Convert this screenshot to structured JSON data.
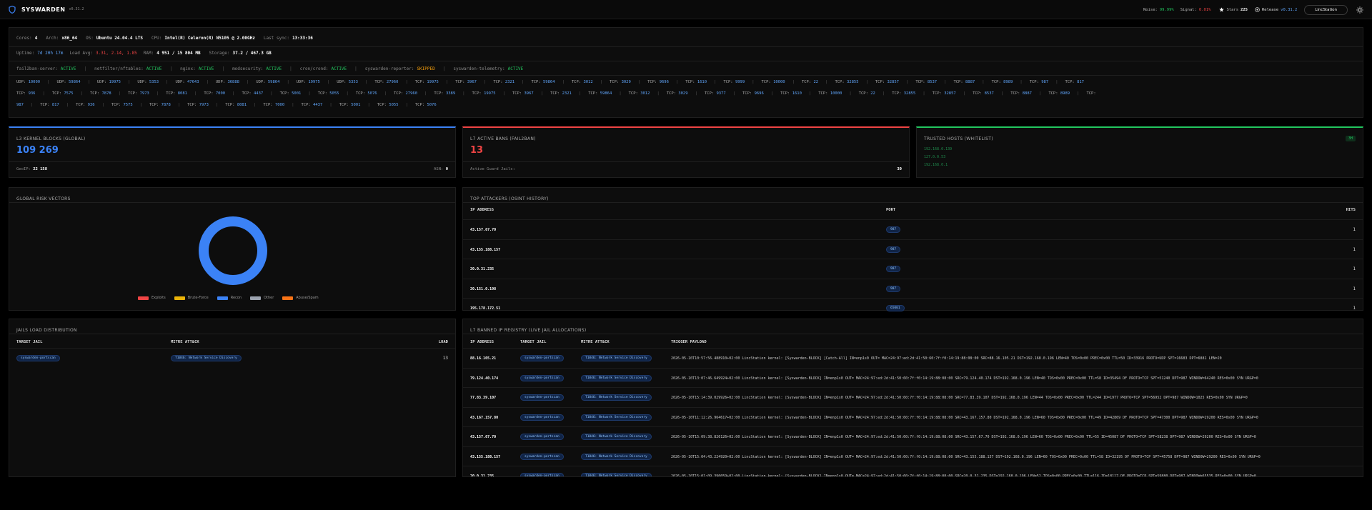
{
  "app": {
    "name": "SYSWARDEN",
    "version": "v0.31.2"
  },
  "topbar": {
    "noise_label": "Noise:",
    "noise_value": "99.99%",
    "signal_label": "Signal:",
    "signal_value": "0.01%",
    "stars_label": "Stars",
    "stars_value": "225",
    "release_label": "Release",
    "release_value": "v0.31.2",
    "host_button": "LincStation"
  },
  "sysinfo": {
    "cores_label": "Cores:",
    "cores": "4",
    "arch_label": "Arch:",
    "arch": "x86_64",
    "os_label": "OS:",
    "os": "Ubuntu 24.04.4 LTS",
    "cpu_label": "CPU:",
    "cpu": "Intel(R) Celeron(R) N5105 @ 2.00GHz",
    "sync_label": "Last sync:",
    "sync": "13:33:36",
    "uptime_label": "Uptime:",
    "uptime": "7d 20h 17m",
    "load_label": "Load Avg:",
    "load": "3.31, 2.14, 1.85",
    "ram_label": "RAM:",
    "ram": "4 951 / 15 804 MB",
    "storage_label": "Storage:",
    "storage": "37.2 / 467.3 GB"
  },
  "services": [
    {
      "name": "fail2ban-server:",
      "status": "ACTIVE",
      "kind": "act"
    },
    {
      "name": "netfilter/nftables:",
      "status": "ACTIVE",
      "kind": "act"
    },
    {
      "name": "nginx:",
      "status": "ACTIVE",
      "kind": "act"
    },
    {
      "name": "modsecurity:",
      "status": "ACTIVE",
      "kind": "act"
    },
    {
      "name": "cron/crond:",
      "status": "ACTIVE",
      "kind": "act"
    },
    {
      "name": "syswarden-reporter:",
      "status": "SKIPPED",
      "kind": "skip"
    },
    {
      "name": "syswarden-telemetry:",
      "status": "ACTIVE",
      "kind": "act"
    }
  ],
  "ports_line1": [
    [
      "UDP:",
      "10000"
    ],
    [
      "UDP:",
      "59864"
    ],
    [
      "UDP:",
      "19975"
    ],
    [
      "UDP:",
      "5353"
    ],
    [
      "UDP:",
      "47643"
    ],
    [
      "UDP:",
      "36888"
    ],
    [
      "UDP:",
      "59864"
    ],
    [
      "UDP:",
      "19975"
    ],
    [
      "UDP:",
      "5353"
    ],
    [
      "TCP:",
      "27960"
    ],
    [
      "TCP:",
      "19975"
    ],
    [
      "TCP:",
      "3967"
    ],
    [
      "TCP:",
      "2321"
    ],
    [
      "TCP:",
      "59864"
    ],
    [
      "TCP:",
      "3012"
    ],
    [
      "TCP:",
      "3029"
    ],
    [
      "TCP:",
      "9696"
    ],
    [
      "TCP:",
      "1610"
    ],
    [
      "TCP:",
      "9999"
    ],
    [
      "TCP:",
      "10000"
    ],
    [
      "TCP:",
      "22"
    ],
    [
      "TCP:",
      "32855"
    ],
    [
      "TCP:",
      "32857"
    ],
    [
      "TCP:",
      "8537"
    ],
    [
      "TCP:",
      "8887"
    ],
    [
      "TCP:",
      "8989"
    ],
    [
      "TCP:",
      "987"
    ],
    [
      "TCP:",
      "817"
    ]
  ],
  "ports_line2": [
    [
      "TCP:",
      "936"
    ],
    [
      "TCP:",
      "7575"
    ],
    [
      "TCP:",
      "7878"
    ],
    [
      "TCP:",
      "7973"
    ],
    [
      "TCP:",
      "8081"
    ],
    [
      "TCP:",
      "7000"
    ],
    [
      "TCP:",
      "4437"
    ],
    [
      "TCP:",
      "5001"
    ],
    [
      "TCP:",
      "5055"
    ],
    [
      "TCP:",
      "5076"
    ],
    [
      "TCP:",
      "27960"
    ],
    [
      "TCP:",
      "3389"
    ],
    [
      "TCP:",
      "19975"
    ],
    [
      "TCP:",
      "3967"
    ],
    [
      "TCP:",
      "2321"
    ],
    [
      "TCP:",
      "59864"
    ],
    [
      "TCP:",
      "3012"
    ],
    [
      "TCP:",
      "3029"
    ],
    [
      "TCP:",
      "9377"
    ],
    [
      "TCP:",
      "9696"
    ],
    [
      "TCP:",
      "1610"
    ],
    [
      "TCP:",
      "10000"
    ],
    [
      "TCP:",
      "22"
    ],
    [
      "TCP:",
      "32855"
    ],
    [
      "TCP:",
      "32857"
    ],
    [
      "TCP:",
      "8537"
    ],
    [
      "TCP:",
      "8887"
    ],
    [
      "TCP:",
      "8989"
    ],
    [
      "TCP:",
      ""
    ]
  ],
  "ports_line3": [
    [
      "",
      "987"
    ],
    [
      "TCP:",
      "817"
    ],
    [
      "TCP:",
      "936"
    ],
    [
      "TCP:",
      "7575"
    ],
    [
      "TCP:",
      "7878"
    ],
    [
      "TCP:",
      "7973"
    ],
    [
      "TCP:",
      "8081"
    ],
    [
      "TCP:",
      "7000"
    ],
    [
      "TCP:",
      "4437"
    ],
    [
      "TCP:",
      "5001"
    ],
    [
      "TCP:",
      "5055"
    ],
    [
      "TCP:",
      "5076"
    ]
  ],
  "kernel": {
    "title": "L3 KERNEL BLOCKS (GLOBAL)",
    "value": "109 269",
    "geoip_label": "GeoIP:",
    "geoip": "22 158",
    "asn_label": "ASN:",
    "asn": "0"
  },
  "bans": {
    "title": "L7 ACTIVE BANS (FAIL2BAN)",
    "value": "13",
    "jails_label": "Active Guard Jails:",
    "jails": "30"
  },
  "trusted": {
    "title": "TRUSTED HOSTS (WHITELIST)",
    "count": "3H",
    "hosts": [
      "192.168.0.139",
      "127.0.0.53",
      "192.168.0.1"
    ]
  },
  "risk": {
    "title": "GLOBAL RISK VECTORS",
    "legend": [
      {
        "label": "Exploits",
        "color": "#ef4444"
      },
      {
        "label": "Brute-Force",
        "color": "#eab308"
      },
      {
        "label": "Recon",
        "color": "#3b82f6"
      },
      {
        "label": "Other",
        "color": "#9ca3af"
      },
      {
        "label": "Abuse/Spam",
        "color": "#f97316"
      }
    ]
  },
  "chart_data": {
    "type": "pie",
    "categories": [
      "Exploits",
      "Brute-Force",
      "Recon",
      "Other",
      "Abuse/Spam"
    ],
    "values": [
      0,
      0,
      100,
      0,
      0
    ]
  },
  "attackers": {
    "title": "TOP ATTACKERS (OSINT HISTORY)",
    "headers": [
      "IP ADDRESS",
      "PORT",
      "HITS"
    ],
    "rows": [
      {
        "ip": "43.157.67.70",
        "port": "987",
        "hits": "1"
      },
      {
        "ip": "43.155.188.157",
        "port": "987",
        "hits": "1"
      },
      {
        "ip": "20.0.31.235",
        "port": "987",
        "hits": "1"
      },
      {
        "ip": "20.151.0.198",
        "port": "987",
        "hits": "1"
      },
      {
        "ip": "195.178.172.51",
        "port": "65001",
        "hits": "1"
      }
    ]
  },
  "jails": {
    "title": "JAILS LOAD DISTRIBUTION",
    "headers": [
      "TARGET JAIL",
      "MITRE ATT&CK",
      "LOAD"
    ],
    "rows": [
      {
        "jail": "syswarden-portscan",
        "mitre": "T1046: Network Service Discovery",
        "load": "13"
      }
    ]
  },
  "registry": {
    "title": "L7 BANNED IP REGISTRY (LIVE JAIL ALLOCATIONS)",
    "headers": [
      "IP ADDRESS",
      "TARGET JAIL",
      "MITRE ATT&CK",
      "TRIGGER PAYLOAD"
    ],
    "rows": [
      {
        "ip": "88.16.105.21",
        "jail": "syswarden-portscan",
        "mitre": "T1046: Network Service Discovery",
        "payload": "2026-05-10T10:57:56.488910+02:00 LincStation kernel: [Syswarden-BLOCK] [Catch-All] IN=enp1s0 OUT= MAC=24:97:ed:2d:41:50:60:7f:f0:14:19:88:08:00 SRC=88.16.105.21 DST=192.168.0.196 LEN=40 TOS=0x00 PREC=0x00 TTL=50 ID=33916 PROTO=UDP SPT=16683 DPT=6881 LEN=20"
      },
      {
        "ip": "79.124.40.174",
        "jail": "syswarden-portscan",
        "mitre": "T1046: Network Service Discovery",
        "payload": "2026-05-10T13:07:46.649924+02:00 LincStation kernel: [Syswarden-BLOCK] IN=enp1s0 OUT= MAC=24:97:ed:2d:41:50:60:7f:f0:14:19:88:08:00 SRC=79.124.40.174 DST=192.168.0.196 LEN=40 TOS=0x00 PREC=0x00 TTL=58 ID=35494 DF PROTO=TCP SPT=51240 DPT=987 WINDOW=64240 RES=0x00 SYN URGP=0"
      },
      {
        "ip": "77.83.39.107",
        "jail": "syswarden-portscan",
        "mitre": "T1046: Network Service Discovery",
        "payload": "2026-05-10T15:14:39.029926+02:00 LincStation kernel: [Syswarden-BLOCK] IN=enp1s0 OUT= MAC=24:97:ed:2d:41:50:60:7f:f0:14:19:88:08:00 SRC=77.83.39.107 DST=192.168.0.196 LEN=44 TOS=0x00 PREC=0x00 TTL=244 ID=1977 PROTO=TCP SPT=56952 DPT=987 WINDOW=1025 RES=0x00 SYN URGP=0"
      },
      {
        "ip": "43.167.157.80",
        "jail": "syswarden-portscan",
        "mitre": "T1046: Network Service Discovery",
        "payload": "2026-05-10T11:12:26.964617+02:00 LincStation kernel: [Syswarden-BLOCK] IN=enp1s0 OUT= MAC=24:97:ed:2d:41:50:60:7f:f0:14:19:88:08:00 SRC=43.167.157.80 DST=192.168.0.196 LEN=60 TOS=0x00 PREC=0x00 TTL=49 ID=42869 DF PROTO=TCP SPT=47300 DPT=987 WINDOW=29200 RES=0x00 SYN URGP=0"
      },
      {
        "ip": "43.157.67.70",
        "jail": "syswarden-portscan",
        "mitre": "T1046: Network Service Discovery",
        "payload": "2026-05-10T15:09:38.826126+02:00 LincStation kernel: [Syswarden-BLOCK] IN=enp1s0 OUT= MAC=24:97:ed:2d:41:50:60:7f:f0:14:19:88:08:00 SRC=43.157.67.70 DST=192.168.0.196 LEN=60 TOS=0x00 PREC=0x00 TTL=55 ID=45087 DF PROTO=TCP SPT=58238 DPT=987 WINDOW=29200 RES=0x00 SYN URGP=0"
      },
      {
        "ip": "43.155.188.157",
        "jail": "syswarden-portscan",
        "mitre": "T1046: Network Service Discovery",
        "payload": "2026-05-10T15:04:43.224920+02:00 LincStation kernel: [Syswarden-BLOCK] IN=enp1s0 OUT= MAC=24:97:ed:2d:41:50:60:7f:f0:14:19:88:08:00 SRC=43.155.188.157 DST=192.168.0.196 LEN=60 TOS=0x00 PREC=0x00 TTL=58 ID=32195 DF PROTO=TCP SPT=45758 DPT=987 WINDOW=29200 RES=0x00 SYN URGP=0"
      },
      {
        "ip": "20.0.31.235",
        "jail": "syswarden-portscan",
        "mitre": "T1046: Network Service Discovery",
        "payload": "2026-05-10T15:01:09.390059+02:00 LincStation kernel: [Syswarden-BLOCK] IN=enp1s0 OUT= MAC=24:97:ed:2d:41:50:60:7f:f0:14:19:88:08:00 SRC=20.0.31.235 DST=192.168.0.196 LEN=52 TOS=0x00 PREC=0x00 TTL=116 ID=18117 DF PROTO=TCP SPT=59880 DPT=987 WINDOW=65535 RES=0x00 SYN URGP=0"
      }
    ]
  }
}
